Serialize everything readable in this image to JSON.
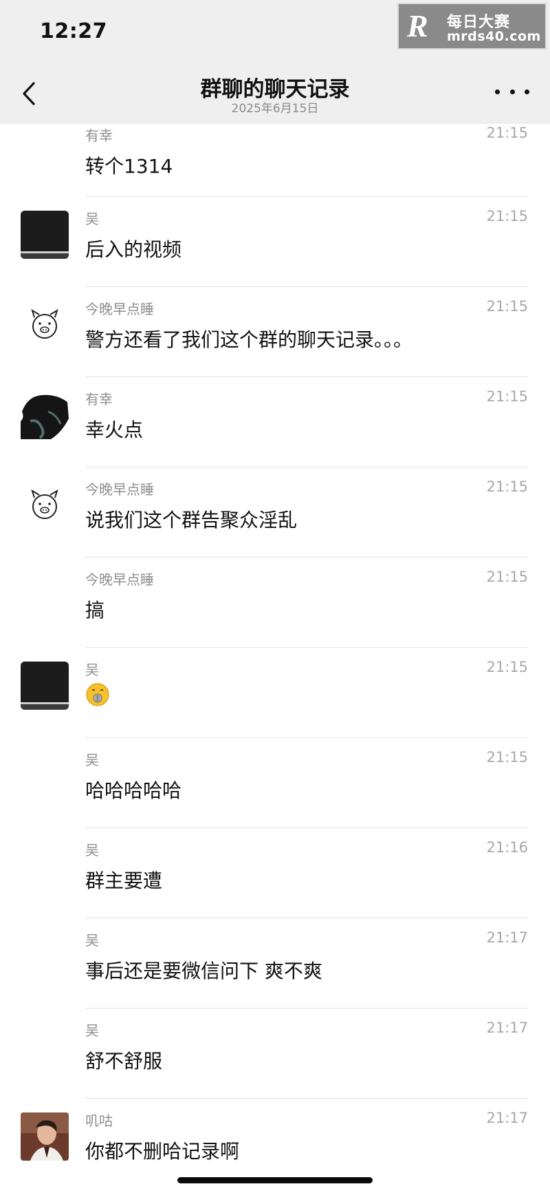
{
  "status_bar": {
    "time": "12:27"
  },
  "watermark": {
    "logo": "R",
    "name": "每日大赛",
    "url": "mrds40.com"
  },
  "nav": {
    "title": "群聊的聊天记录",
    "subtitle": "2025年6月15日",
    "back_icon": "chevron-left-icon",
    "more_icon": "more-dots-icon"
  },
  "messages": [
    {
      "sender": "有幸",
      "time": "21:15",
      "text": "转个1314"
    },
    {
      "sender": "吴",
      "time": "21:15",
      "text": "后入的视频"
    },
    {
      "sender": "今晚早点睡",
      "time": "21:15",
      "text": "警方还看了我们这个群的聊天记录。。。"
    },
    {
      "sender": "有幸",
      "time": "21:15",
      "text": "幸火点"
    },
    {
      "sender": "今晚早点睡",
      "time": "21:15",
      "text": "说我们这个群告聚众淫乱"
    },
    {
      "sender": "今晚早点睡",
      "time": "21:15",
      "text": "搞"
    },
    {
      "sender": "吴",
      "time": "21:15",
      "text": "",
      "emoji": "zipper-mouth-face-emoji"
    },
    {
      "sender": "吴",
      "time": "21:15",
      "text": "哈哈哈哈哈"
    },
    {
      "sender": "吴",
      "time": "21:16",
      "text": "群主要遭"
    },
    {
      "sender": "吴",
      "time": "21:17",
      "text": "事后还是要微信问下 爽不爽"
    },
    {
      "sender": "吴",
      "time": "21:17",
      "text": "舒不舒服"
    },
    {
      "sender": "叽咕",
      "time": "21:17",
      "text": "你都不删哈记录啊"
    }
  ]
}
